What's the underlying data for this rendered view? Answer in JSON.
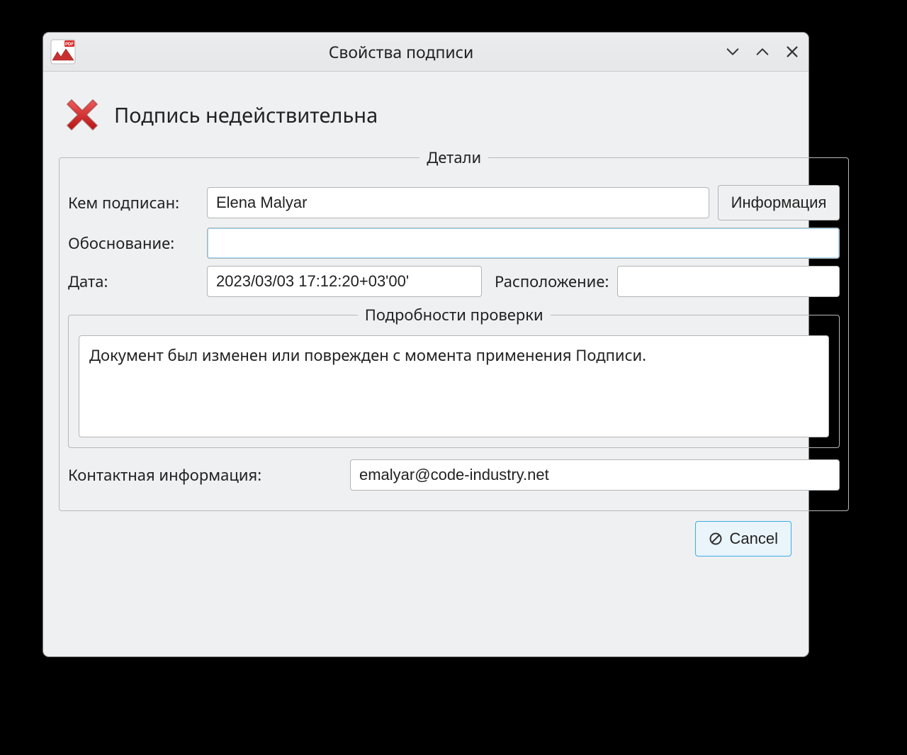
{
  "titlebar": {
    "title": "Свойства подписи"
  },
  "status": {
    "text": "Подпись недействительна"
  },
  "details": {
    "legend": "Детали",
    "signed_by_label": "Кем подписан:",
    "signed_by_value": "Elena Malyar",
    "info_button": "Информация",
    "reason_label": "Обоснование:",
    "reason_value": "",
    "date_label": "Дата:",
    "date_value": "2023/03/03 17:12:20+03'00'",
    "location_label": "Расположение:",
    "location_value": "",
    "verify": {
      "legend": "Подробности проверки",
      "message": "Документ был изменен или поврежден с момента применения Подписи."
    },
    "contact_label": "Контактная информация:",
    "contact_value": "emalyar@code-industry.net"
  },
  "footer": {
    "cancel_label": "Cancel"
  },
  "icons": {
    "app": "pdf-app-icon",
    "status": "error-x-icon",
    "minimize": "chevron-down-icon",
    "maximize": "chevron-up-icon",
    "close": "close-icon",
    "cancel": "cancel-icon"
  }
}
